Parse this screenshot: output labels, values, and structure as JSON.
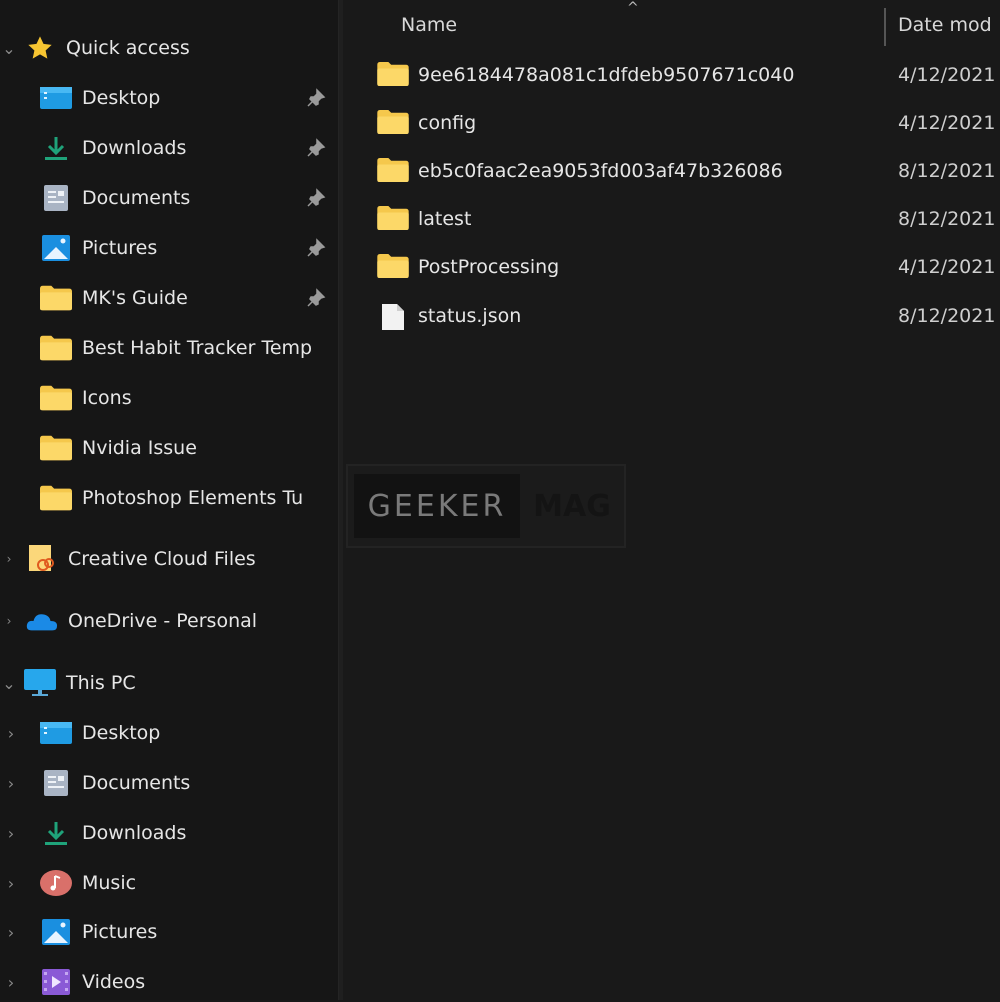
{
  "navigation": {
    "quick_access": {
      "label": "Quick access",
      "items": [
        {
          "label": "Desktop",
          "icon": "desktop-icon",
          "pinned": true
        },
        {
          "label": "Downloads",
          "icon": "download-icon",
          "pinned": true
        },
        {
          "label": "Documents",
          "icon": "documents-icon",
          "pinned": true
        },
        {
          "label": "Pictures",
          "icon": "pictures-icon",
          "pinned": true
        },
        {
          "label": "MK's Guide",
          "icon": "folder-icon",
          "pinned": true
        },
        {
          "label": "Best Habit Tracker Temp",
          "icon": "folder-icon",
          "pinned": false
        },
        {
          "label": "Icons",
          "icon": "folder-icon",
          "pinned": false
        },
        {
          "label": "Nvidia Issue",
          "icon": "folder-icon",
          "pinned": false
        },
        {
          "label": "Photoshop Elements Tu",
          "icon": "folder-icon",
          "pinned": false
        }
      ]
    },
    "creative_cloud": {
      "label": "Creative Cloud Files",
      "icon": "creative-cloud-icon"
    },
    "onedrive": {
      "label": "OneDrive - Personal",
      "icon": "onedrive-icon"
    },
    "this_pc": {
      "label": "This PC",
      "icon": "this-pc-icon",
      "items": [
        {
          "label": "Desktop",
          "icon": "desktop-icon"
        },
        {
          "label": "Documents",
          "icon": "documents-icon"
        },
        {
          "label": "Downloads",
          "icon": "download-icon"
        },
        {
          "label": "Music",
          "icon": "music-icon"
        },
        {
          "label": "Pictures",
          "icon": "pictures-icon"
        },
        {
          "label": "Videos",
          "icon": "videos-icon"
        }
      ]
    }
  },
  "file_list": {
    "columns": {
      "name": "Name",
      "date": "Date mod"
    },
    "sort_indicator": "^",
    "rows": [
      {
        "name": "9ee6184478a081c1dfdeb9507671c040",
        "type": "folder",
        "date": "4/12/2021"
      },
      {
        "name": "config",
        "type": "folder",
        "date": "4/12/2021"
      },
      {
        "name": "eb5c0faac2ea9053fd003af47b326086",
        "type": "folder",
        "date": "8/12/2021"
      },
      {
        "name": "latest",
        "type": "folder",
        "date": "8/12/2021"
      },
      {
        "name": "PostProcessing",
        "type": "folder",
        "date": "4/12/2021"
      },
      {
        "name": "status.json",
        "type": "file",
        "date": "8/12/2021"
      }
    ]
  },
  "watermark": {
    "left": "GEEKER",
    "right": "MAG"
  },
  "colors": {
    "background": "#191919",
    "folder": "#f5c84c",
    "accent_blue": "#1a9be6",
    "download_green": "#1fa37a"
  }
}
